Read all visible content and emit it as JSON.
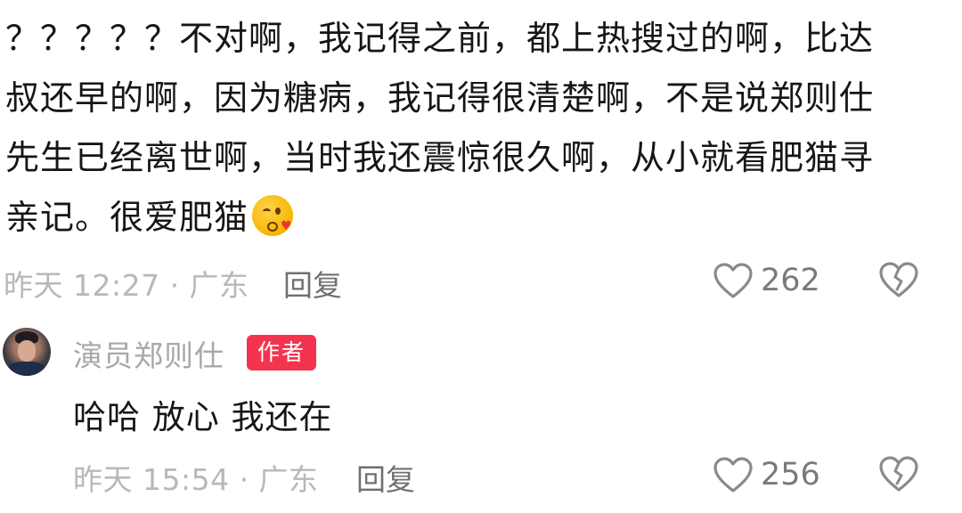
{
  "comment": {
    "text": "？？？？？不对啊，我记得之前，都上热搜过的啊，比达叔还早的啊，因为糖病，我记得很清楚啊，不是说郑则仕先生已经离世啊，当时我还震惊很久啊，从小就看肥猫寻亲记。很爱肥猫",
    "emoji": "kissing-face-with-heart-emoji",
    "time_location": "昨天 12:27 · 广东",
    "reply_label": "回复",
    "like_count": "262"
  },
  "reply": {
    "author_name": "演员郑则仕",
    "author_badge": "作者",
    "text": "哈哈 放心 我还在",
    "time_location": "昨天 15:54 · 广东",
    "reply_label": "回复",
    "like_count": "256"
  },
  "colors": {
    "badge_bg": "#f4344f",
    "meta_text": "#b8b8b8",
    "icon_stroke": "#8a8a8a"
  },
  "icons": {
    "like": "heart-outline-icon",
    "dislike": "broken-heart-icon"
  }
}
